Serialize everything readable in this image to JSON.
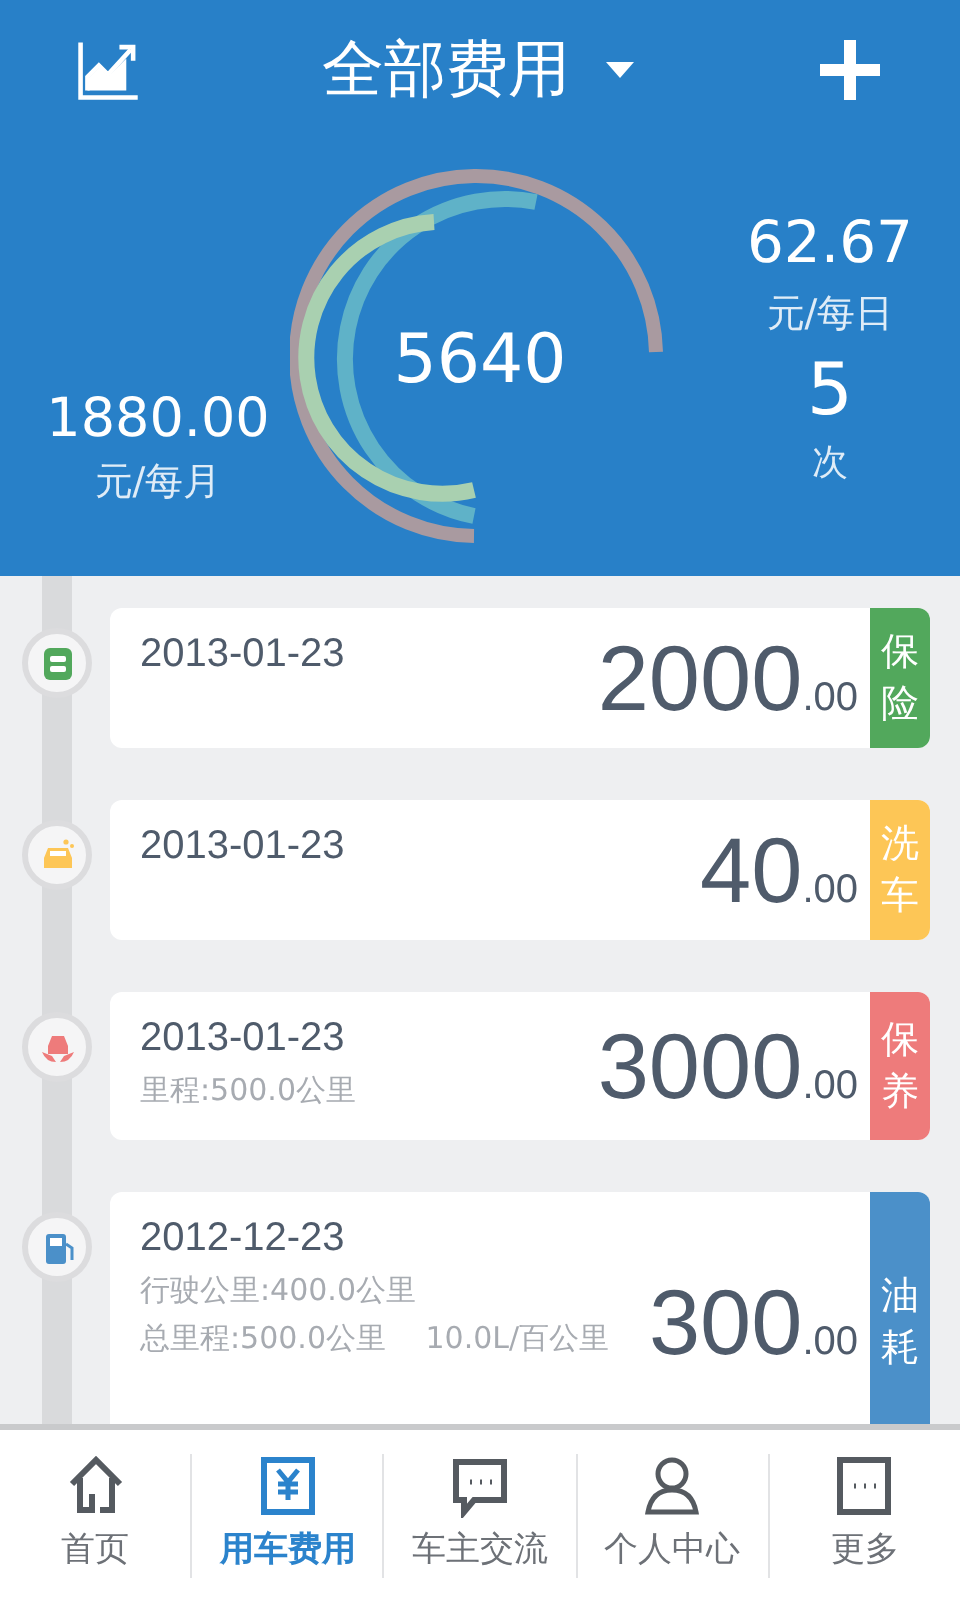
{
  "header": {
    "title": "全部费用",
    "total": "5640",
    "monthly": {
      "value": "1880.00",
      "unit": "元/每月"
    },
    "daily": {
      "value": "62.67",
      "unit": "元/每日"
    },
    "count": {
      "value": "5",
      "unit": "次"
    }
  },
  "records": [
    {
      "kind": "insurance",
      "date": "2013-01-23",
      "amount": "2000",
      "decimals": ".00",
      "tag": "保险",
      "color": "#52a85c"
    },
    {
      "kind": "wash",
      "date": "2013-01-23",
      "amount": "40",
      "decimals": ".00",
      "tag": "洗车",
      "color": "#fdc656"
    },
    {
      "kind": "maintenance",
      "date": "2013-01-23",
      "amount": "3000",
      "decimals": ".00",
      "tag": "保养",
      "color": "#ee7b7b",
      "details": [
        "里程:500.0公里"
      ]
    },
    {
      "kind": "fuel",
      "date": "2012-12-23",
      "amount": "300",
      "decimals": ".00",
      "tag": "油耗",
      "color": "#4b90c9",
      "details": [
        "行驶公里:400.0公里",
        "总里程:500.0公里　 10.0L/百公里"
      ]
    }
  ],
  "nav": [
    {
      "kind": "home",
      "label": "首页",
      "selected": false
    },
    {
      "kind": "fee",
      "label": "用车费用",
      "selected": true
    },
    {
      "kind": "chat",
      "label": "车主交流",
      "selected": false
    },
    {
      "kind": "person",
      "label": "个人中心",
      "selected": false
    },
    {
      "kind": "more",
      "label": "更多",
      "selected": false
    }
  ]
}
